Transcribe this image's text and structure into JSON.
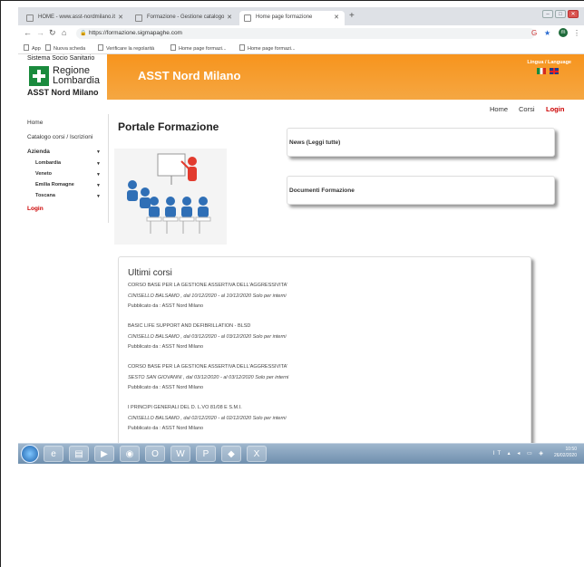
{
  "browser": {
    "tabs": [
      {
        "label": "HOME - www.asst-nordmilano.it"
      },
      {
        "label": "Formazione - Gestione catalogo"
      },
      {
        "label": "Home page formazione"
      }
    ],
    "url": "https://formazione.sigmapaghe.com",
    "profile_initial": "m",
    "bookmarks": [
      {
        "label": "App"
      },
      {
        "label": "Nuova scheda"
      },
      {
        "label": "Verificare la regolarità"
      },
      {
        "label": "Home page formazi..."
      },
      {
        "label": "Home page formazi..."
      }
    ]
  },
  "site": {
    "system_label": "Sistema Socio Sanitario",
    "region_line1": "Regione",
    "region_line2": "Lombardia",
    "org_label": "ASST Nord Milano",
    "header_title": "ASST Nord Milano",
    "language_label": "Lingua / Language"
  },
  "topnav": {
    "home": "Home",
    "corsi": "Corsi",
    "login": "Login"
  },
  "sidebar": {
    "home": "Home",
    "catalogo": "Catalogo corsi / Iscrizioni",
    "azienda": "Azienda",
    "regions": [
      "Lombardia",
      "Veneto",
      "Emilia Romagne",
      "Toscana"
    ],
    "login": "Login"
  },
  "page_title": "Portale Formazione",
  "panels": {
    "news": "News (Leggi tutte)",
    "documents": "Documenti Formazione"
  },
  "courses": {
    "title": "Ultimi corsi",
    "items": [
      {
        "name": "CORSO BASE PER LA GESTIONE ASSERTIVA DELL'AGGRESSIVITA'",
        "date": "CINISELLO BALSAMO , dal 10/12/2020 - al 10/12/2020 Solo per interni",
        "publisher": "Pubblicato da : ASST Nord Milano"
      },
      {
        "name": "BASIC LIFE SUPPORT AND DEFIBRILLATION - BLSD",
        "date": "CINISELLO BALSAMO , dal 03/12/2020 - al 03/12/2020 Solo per interni",
        "publisher": "Pubblicato da : ASST Nord Milano"
      },
      {
        "name": "CORSO BASE PER LA GESTIONE ASSERTIVA DELL'AGGRESSIVITA'",
        "date": "SESTO SAN GIOVANNI , dal 03/12/2020 - al 03/12/2020 Solo per interni",
        "publisher": "Pubblicato da : ASST Nord Milano"
      },
      {
        "name": "I PRINCIPI GENERALI DEL D. L.VO 81/08 E S.M.I.",
        "date": "CINISELLO BALSAMO , dal 02/12/2020 - al 02/12/2020 Solo per interni",
        "publisher": "Pubblicato da : ASST Nord Milano"
      }
    ]
  },
  "taskbar": {
    "apps": [
      "ie-icon",
      "folder-icon",
      "media-player-icon",
      "chrome-icon",
      "outlook-icon",
      "word-icon",
      "powerpoint-icon",
      "app-icon",
      "excel-icon"
    ],
    "time": "10:50",
    "date": "26/02/2020",
    "lang": "IT"
  }
}
